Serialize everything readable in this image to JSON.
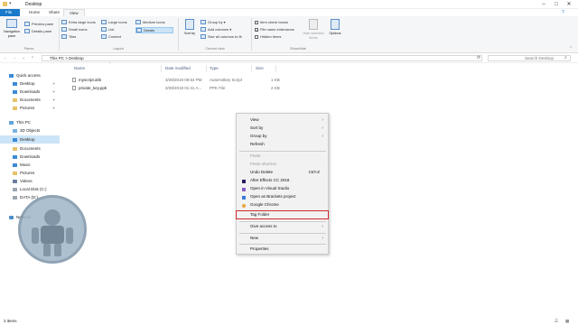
{
  "window": {
    "title": "Desktop"
  },
  "ribbon_tabs": [
    "File",
    "Home",
    "Share",
    "View"
  ],
  "ribbon": {
    "navigation_pane": "Navigation pane",
    "preview_pane": "Preview pane",
    "details_pane": "Details pane",
    "panes_group": "Panes",
    "layout_items": [
      "Extra large icons",
      "Large icons",
      "Medium icons",
      "Small icons",
      "List",
      "Details",
      "Tiles",
      "Content"
    ],
    "layout_group": "Layout",
    "sort_by": "Sort by",
    "group_by": "Group by",
    "add_columns": "Add columns",
    "size_all_columns": "Size all columns to fit",
    "current_view_group": "Current view",
    "item_check_boxes": "Item check boxes",
    "file_name_extensions": "File name extensions",
    "hidden_items": "Hidden items",
    "hide_selected_items": "Hide selected items",
    "options": "Options",
    "show_hide_group": "Show/hide"
  },
  "address": {
    "path": "This PC  >  Desktop",
    "search_placeholder": "Search Desktop"
  },
  "nav_pane": {
    "items": [
      {
        "label": "Quick access",
        "type": "qa"
      },
      {
        "label": "Desktop",
        "type": "folder",
        "pinned": true
      },
      {
        "label": "Downloads",
        "type": "folder",
        "pinned": true
      },
      {
        "label": "Documents",
        "type": "folder",
        "pinned": true
      },
      {
        "label": "Pictures",
        "type": "folder",
        "pinned": true
      },
      {
        "label": "This PC",
        "type": "pc"
      },
      {
        "label": "3D Objects",
        "type": "folder"
      },
      {
        "label": "Desktop",
        "type": "folder",
        "selected": true
      },
      {
        "label": "Documents",
        "type": "folder"
      },
      {
        "label": "Downloads",
        "type": "folder"
      },
      {
        "label": "Music",
        "type": "folder"
      },
      {
        "label": "Pictures",
        "type": "folder"
      },
      {
        "label": "Videos",
        "type": "folder"
      },
      {
        "label": "Local Disk (C:)",
        "type": "drive"
      },
      {
        "label": "DATA (D:)",
        "type": "drive"
      },
      {
        "label": "Network",
        "type": "net"
      }
    ]
  },
  "file_list": {
    "columns": [
      "Name",
      "Date modified",
      "Type",
      "Size"
    ],
    "rows": [
      {
        "name": "myscript.ahk",
        "date": "3/28/2019 09:54 PM",
        "type": "AutoHotkey Script",
        "size": "1 KB"
      },
      {
        "name": "private_key.ppk",
        "date": "3/28/2019 01:41 A...",
        "type": "PPK File",
        "size": "2 KB"
      }
    ]
  },
  "context_menu": {
    "items": [
      {
        "label": "View",
        "submenu": true
      },
      {
        "label": "Sort by",
        "submenu": true
      },
      {
        "label": "Group by",
        "submenu": true
      },
      {
        "label": "Refresh"
      },
      {
        "sep": true
      },
      {
        "label": "Paste",
        "disabled": true
      },
      {
        "label": "Paste shortcut",
        "disabled": true
      },
      {
        "label": "Undo Delete",
        "shortcut": "Ctrl+Z"
      },
      {
        "label": "After Effects CC 2018",
        "icon": "#2a1e5c"
      },
      {
        "label": "Open in Visual Studio",
        "icon": "#865fc5"
      },
      {
        "label": "Open as Brackets project",
        "icon": "#3a7bd5"
      },
      {
        "label": "Google Chrome",
        "icon": "#e8a43a"
      },
      {
        "label": "Tag Folder",
        "highlighted": true
      },
      {
        "sep": true
      },
      {
        "label": "Give access to",
        "submenu": true
      },
      {
        "sep": true
      },
      {
        "label": "New",
        "submenu": true
      },
      {
        "sep": true
      },
      {
        "label": "Properties"
      }
    ]
  },
  "status_bar": {
    "count": "2 items"
  },
  "colors": {
    "accent": "#1979ca",
    "selection": "#cce4f7",
    "highlight_box": "#d12b2b"
  }
}
